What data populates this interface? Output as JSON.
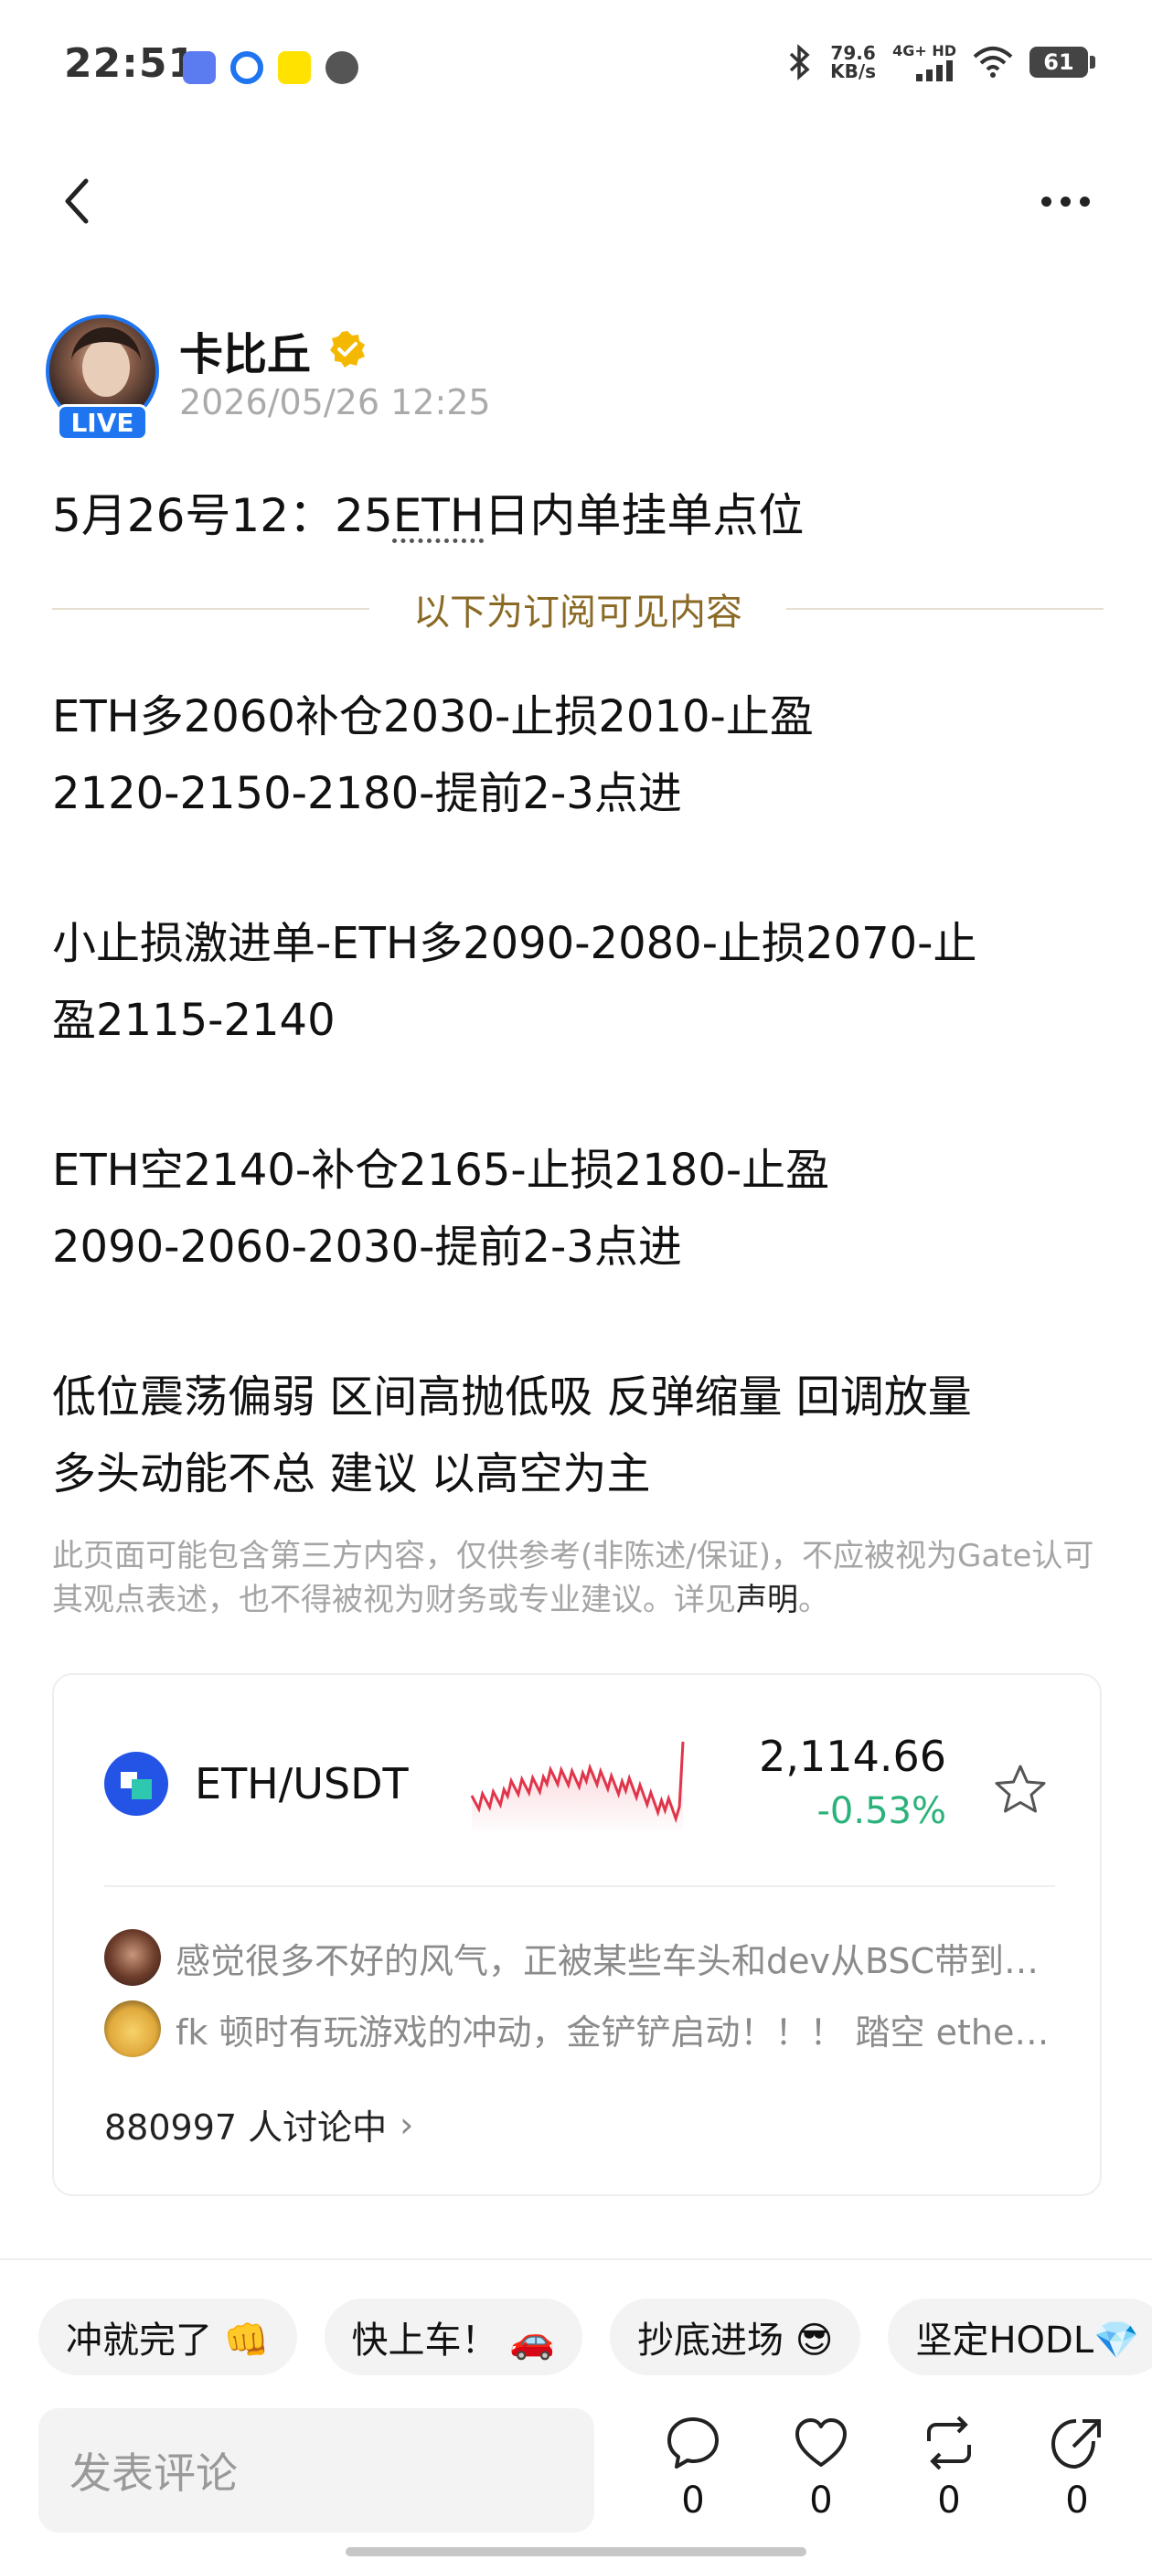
{
  "status_bar": {
    "time": "22:51",
    "net_speed_value": "79.6",
    "net_speed_unit": "KB/s",
    "network": "4G+ HD",
    "battery": "61",
    "icons": [
      "bluetooth-icon",
      "signal-icon",
      "wifi-icon",
      "battery-icon"
    ]
  },
  "nav": {
    "back_icon": "chevron-left-icon",
    "more_icon": "more-horizontal-icon"
  },
  "author": {
    "name": "卡比丘",
    "live_label": "LIVE",
    "timestamp": "2026/05/26 12:25",
    "verified_color": "#f5b800"
  },
  "post": {
    "title_prefix": "5月26号12：25",
    "title_link": "ETH",
    "title_suffix": "日内单挂单点位",
    "subscription_divider": "以下为订阅可见内容",
    "paragraphs": [
      [
        "ETH多2060补仓2030-止损2010-止盈",
        "2120-2150-2180-提前2-3点进"
      ],
      [
        "小止损激进单-ETH多2090-2080-止损2070-止",
        "盈2115-2140"
      ],
      [
        "ETH空2140-补仓2165-止损2180-止盈",
        "2090-2060-2030-提前2-3点进"
      ],
      [
        "低位震荡偏弱 区间高抛低吸 反弹缩量 回调放量",
        "多头动能不总 建议 以高空为主"
      ]
    ],
    "disclaimer_text": "此页面可能包含第三方内容，仅供参考(非陈述/保证)，不应被视为Gate认可其观点表述，也不得被视为财务或专业建议。详见",
    "disclaimer_link": "声明",
    "disclaimer_end": "。"
  },
  "market_card": {
    "pair": "ETH/USDT",
    "price": "2,114.66",
    "change": "-0.53%",
    "change_color": "#2bb27a",
    "sparkline_color": "#e0354a",
    "comments": [
      "感觉很多不好的风气，正被某些车头和dev从BSC带到…",
      "fk 顿时有玩游戏的冲动，金铲铲启动！！！ 踏空 ether…"
    ],
    "discussion_count": "880997 人讨论中"
  },
  "quick_replies": [
    "冲就完了 👊",
    "快上车！ 🚗",
    "抄底进场 😎",
    "坚定HODL💎"
  ],
  "bottom_bar": {
    "comment_placeholder": "发表评论",
    "actions": [
      {
        "icon": "comment-icon",
        "count": "0"
      },
      {
        "icon": "heart-icon",
        "count": "0"
      },
      {
        "icon": "repost-icon",
        "count": "0"
      },
      {
        "icon": "share-icon",
        "count": "0"
      }
    ]
  }
}
